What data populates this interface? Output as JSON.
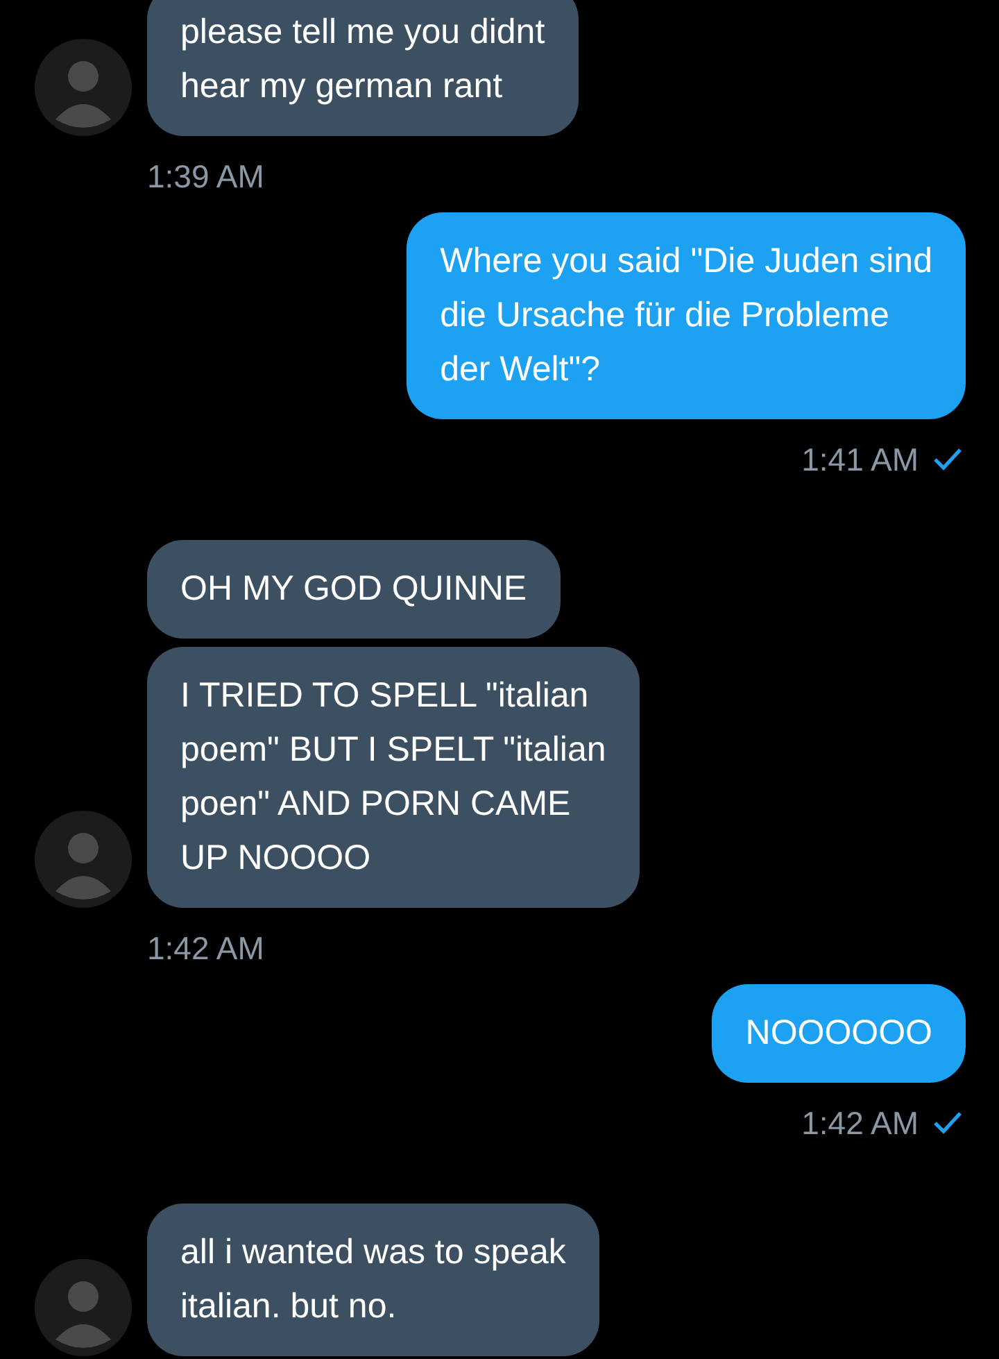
{
  "messages": [
    {
      "kind": "received",
      "bubbles": [
        "please tell me you didnt\nhear my german rant"
      ],
      "time": "1:39 AM"
    },
    {
      "kind": "sent",
      "bubbles": [
        "Where you said \"Die Juden sind\ndie Ursache für die Probleme\nder Welt\"?"
      ],
      "time": "1:41 AM",
      "read": true
    },
    {
      "kind": "received",
      "bubbles": [
        "OH MY GOD QUINNE",
        "I TRIED TO SPELL \"italian\npoem\" BUT I SPELT \"italian\npoen\" AND PORN CAME\nUP NOOOO"
      ],
      "time": "1:42 AM"
    },
    {
      "kind": "sent",
      "bubbles": [
        "NOOOOOO"
      ],
      "time": "1:42 AM",
      "read": true
    },
    {
      "kind": "received",
      "bubbles": [
        "all i wanted was to speak\nitalian. but no."
      ]
    }
  ]
}
